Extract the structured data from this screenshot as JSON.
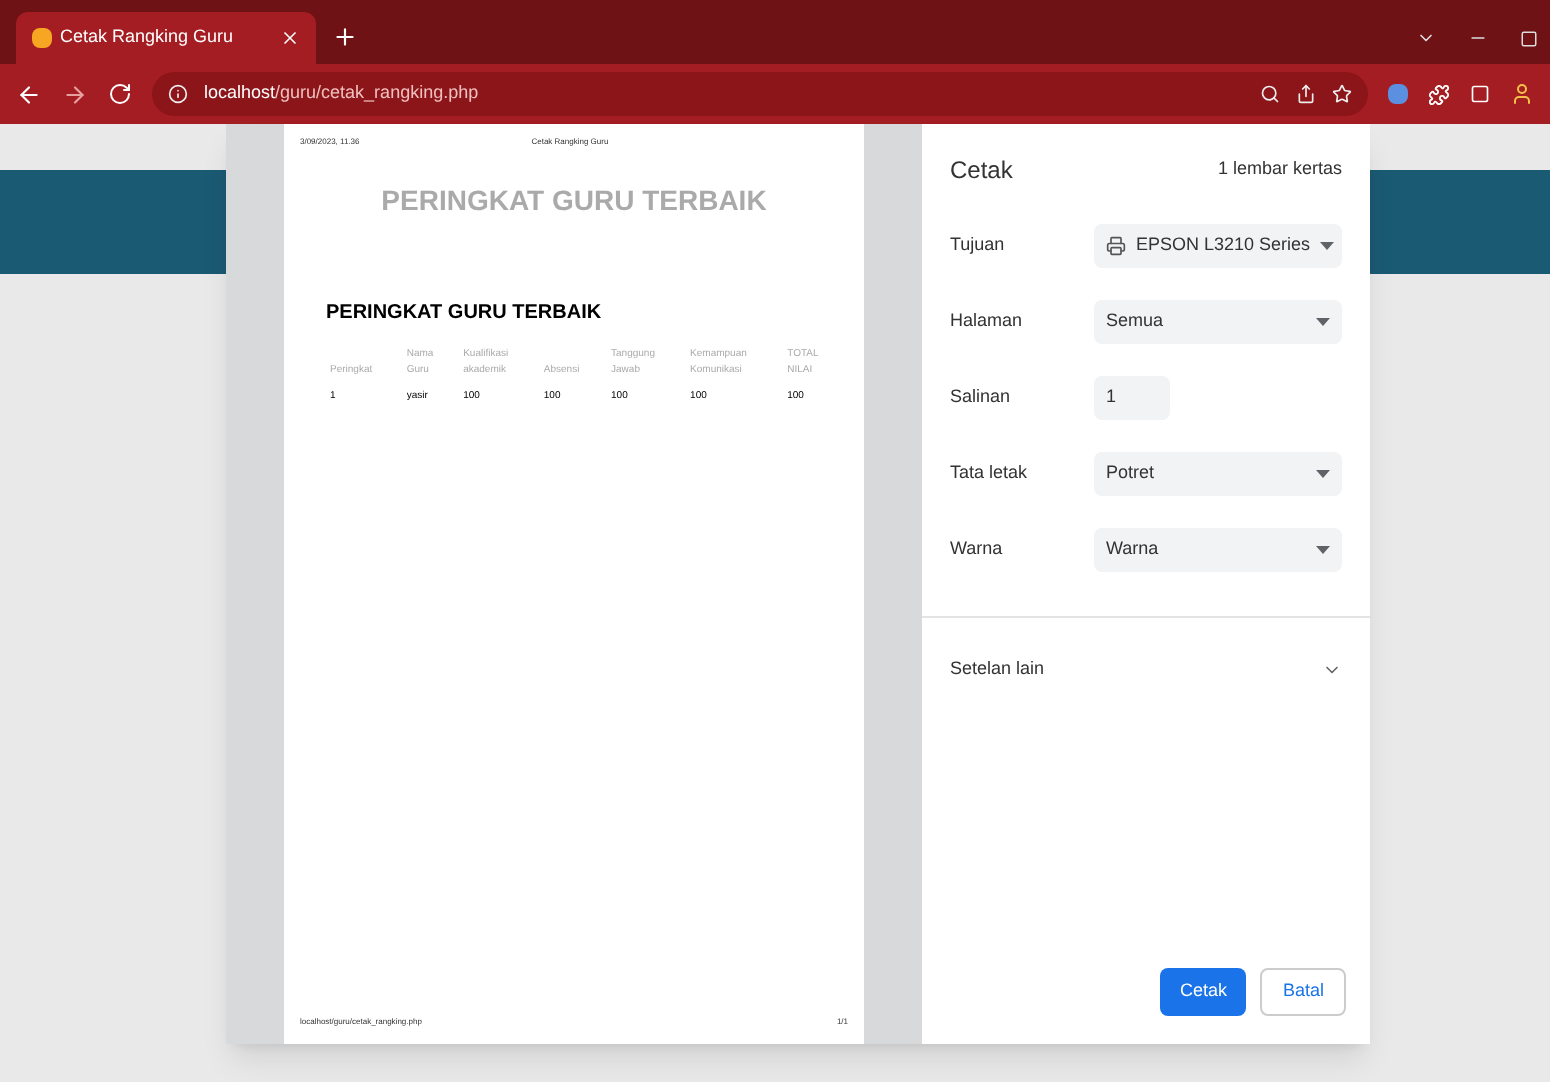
{
  "browser": {
    "tab": {
      "title": "Cetak Rangking Guru",
      "selected": true
    },
    "address": {
      "host": "localhost",
      "path": "/guru/cetak_rangking.php"
    }
  },
  "preview": {
    "header_date": "3/09/2023, 11.36",
    "header_title": "Cetak Rangking Guru",
    "heading": "PERINGKAT GURU TERBAIK",
    "subheading": "PERINGKAT GURU TERBAIK",
    "columns": [
      "Peringkat",
      "Nama Guru",
      "Kualifikasi akademik",
      "Absensi",
      "Tanggung Jawab",
      "Kemampuan Komunikasi",
      "TOTAL NILAI"
    ],
    "rows": [
      [
        "1",
        "yasir",
        "100",
        "100",
        "100",
        "100",
        "100"
      ]
    ],
    "footer_url": "localhost/guru/cetak_rangking.php",
    "footer_page": "1/1"
  },
  "print": {
    "title": "Cetak",
    "sheets": "1 lembar kertas",
    "settings": [
      {
        "label": "Tujuan",
        "value": "EPSON L3210 Series",
        "kind": "printer"
      },
      {
        "label": "Halaman",
        "value": "Semua",
        "kind": "select"
      },
      {
        "label": "Salinan",
        "value": "1",
        "kind": "input"
      },
      {
        "label": "Tata letak",
        "value": "Potret",
        "kind": "select"
      },
      {
        "label": "Warna",
        "value": "Warna",
        "kind": "select"
      }
    ],
    "more": "Setelan lain",
    "buttons": [
      "Cetak",
      "Batal"
    ]
  }
}
